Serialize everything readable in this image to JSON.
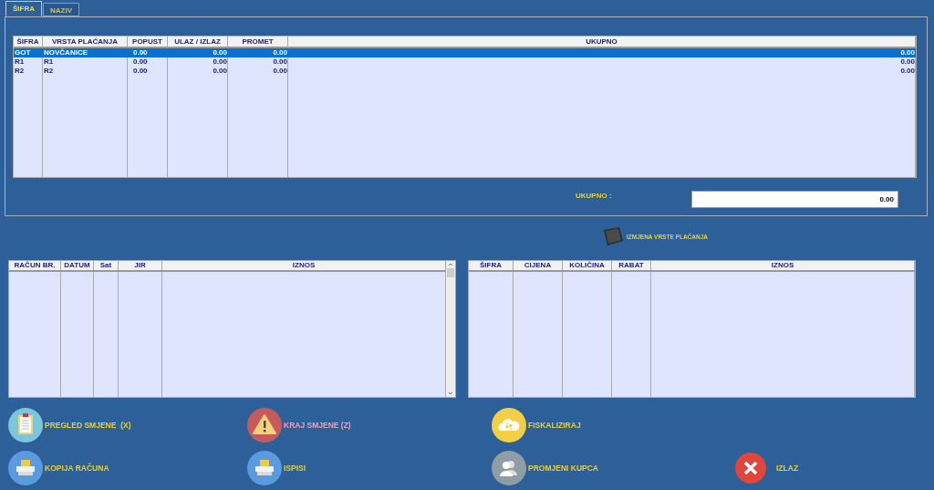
{
  "tabs": [
    {
      "label": "ŠIFRA",
      "selected": true
    },
    {
      "label": "NAZIV",
      "selected": false
    }
  ],
  "payments_table": {
    "columns": [
      "ŠIFRA",
      "VRSTA PLAĆANJA",
      "POPUST",
      "ULAZ / IZLAZ",
      "PROMET",
      "UKUPNO"
    ],
    "rows": [
      {
        "cells": [
          "GOT",
          "NOVČANICE",
          "0.00",
          "0.00",
          "0.00",
          "0.00"
        ],
        "selected": true
      },
      {
        "cells": [
          "R1",
          "R1",
          "0.00",
          "0.00",
          "0.00",
          "0.00"
        ],
        "selected": false
      },
      {
        "cells": [
          "R2",
          "R2",
          "0.00",
          "0.00",
          "0.00",
          "0.00"
        ],
        "selected": false
      }
    ]
  },
  "total": {
    "label": "UKUPNO :",
    "value": "0.00"
  },
  "change_payment_button": {
    "label": "IZMJENA VRSTE PLAĆANJA"
  },
  "receipts_table": {
    "columns": [
      "RAČUN BR.",
      "DATUM",
      "Sat",
      "JIR",
      "IZNOS"
    ]
  },
  "items_table": {
    "columns": [
      "ŠIFRA",
      "CIJENA",
      "KOLIČINA",
      "RABAT",
      "IZNOS"
    ]
  },
  "actions": [
    {
      "label": "PREGLED SMJENE  (X)",
      "kind": "clipboard",
      "color": "#e6cf3c"
    },
    {
      "label": "KRAJ SMJENE (Z)",
      "kind": "warning",
      "color": "#e7a3b6"
    },
    {
      "label": "FISKALIZIRAJ",
      "kind": "cloud",
      "color": "#e6cf3c"
    },
    {
      "label": "KOPIJA RAČUNA",
      "kind": "printer",
      "color": "#e6cf3c"
    },
    {
      "label": "ISPISI",
      "kind": "printer",
      "color": "#e6cf3c"
    },
    {
      "label": "PROMJENI KUPCA",
      "kind": "users",
      "color": "#e6cf3c"
    },
    {
      "label": "IZLAZ",
      "kind": "close",
      "color": "#e6cf3c"
    }
  ]
}
